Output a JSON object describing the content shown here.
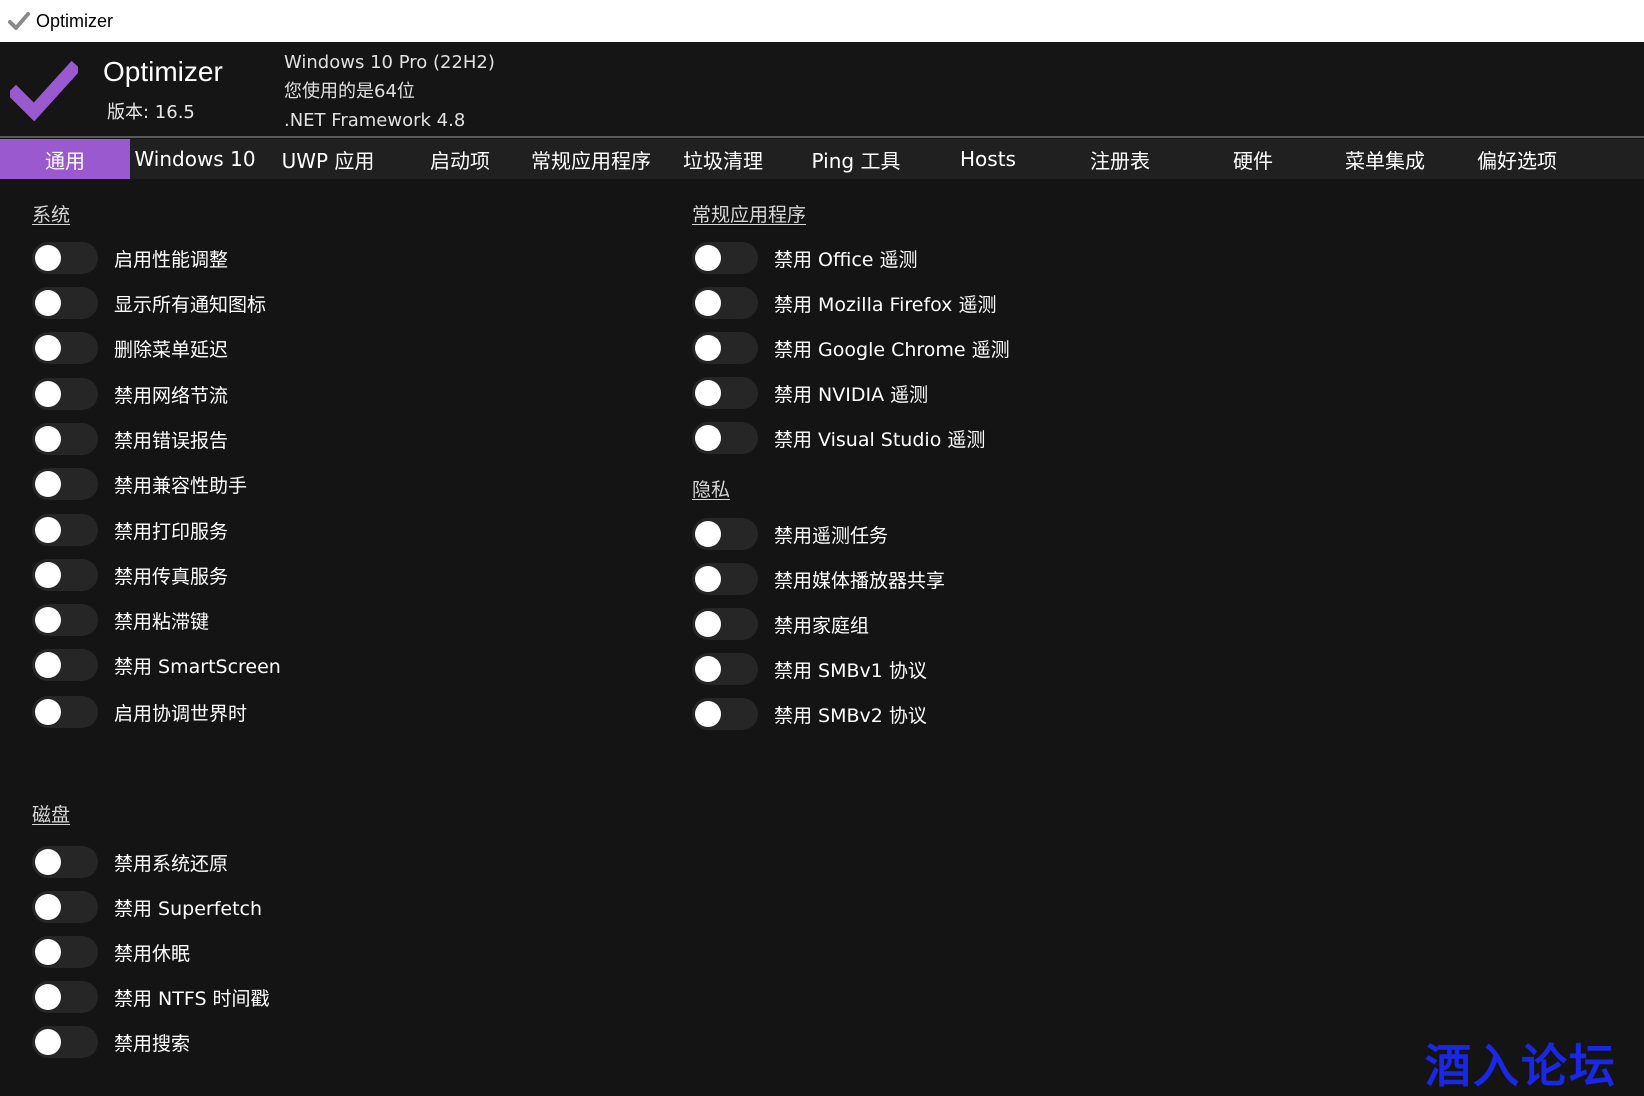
{
  "window": {
    "title": "Optimizer"
  },
  "header": {
    "app_name": "Optimizer",
    "version": "版本: 16.5",
    "os": "Windows 10 Pro (22H2)",
    "arch": "您使用的是64位",
    "framework": ".NET Framework 4.8"
  },
  "colors": {
    "accent": "#9b59d0",
    "background": "#141414",
    "tabbar": "#202020",
    "toggle_off": "#262626",
    "watermark": "#1a27e6"
  },
  "tabs": [
    {
      "label": "通用",
      "active": true
    },
    {
      "label": "Windows 10"
    },
    {
      "label": "UWP 应用"
    },
    {
      "label": "启动项"
    },
    {
      "label": "常规应用程序"
    },
    {
      "label": "垃圾清理"
    },
    {
      "label": "Ping 工具"
    },
    {
      "label": "Hosts"
    },
    {
      "label": "注册表"
    },
    {
      "label": "硬件"
    },
    {
      "label": "菜单集成"
    },
    {
      "label": "偏好选项"
    }
  ],
  "sections": {
    "system": {
      "title": "系统",
      "items": [
        {
          "label": "启用性能调整",
          "on": false
        },
        {
          "label": "显示所有通知图标",
          "on": false
        },
        {
          "label": "删除菜单延迟",
          "on": false
        },
        {
          "label": "禁用网络节流",
          "on": false
        },
        {
          "label": "禁用错误报告",
          "on": false
        },
        {
          "label": "禁用兼容性助手",
          "on": false
        },
        {
          "label": "禁用打印服务",
          "on": false
        },
        {
          "label": "禁用传真服务",
          "on": false
        },
        {
          "label": "禁用粘滞键",
          "on": false
        },
        {
          "label": "禁用 SmartScreen",
          "on": false
        },
        {
          "label": "启用协调世界时",
          "on": false
        }
      ]
    },
    "disk": {
      "title": "磁盘",
      "items": [
        {
          "label": "禁用系统还原",
          "on": false
        },
        {
          "label": "禁用 Superfetch",
          "on": false
        },
        {
          "label": "禁用休眠",
          "on": false
        },
        {
          "label": "禁用 NTFS 时间戳",
          "on": false
        },
        {
          "label": "禁用搜索",
          "on": false
        }
      ]
    },
    "apps": {
      "title": "常规应用程序",
      "items": [
        {
          "label": "禁用 Office 遥测",
          "on": false
        },
        {
          "label": "禁用 Mozilla Firefox 遥测",
          "on": false
        },
        {
          "label": "禁用 Google Chrome 遥测",
          "on": false
        },
        {
          "label": "禁用 NVIDIA 遥测",
          "on": false
        },
        {
          "label": "禁用 Visual Studio 遥测",
          "on": false
        }
      ]
    },
    "privacy": {
      "title": "隐私",
      "items": [
        {
          "label": "禁用遥测任务",
          "on": false
        },
        {
          "label": "禁用媒体播放器共享",
          "on": false
        },
        {
          "label": "禁用家庭组",
          "on": false
        },
        {
          "label": "禁用 SMBv1 协议",
          "on": false
        },
        {
          "label": "禁用 SMBv2 协议",
          "on": false
        }
      ]
    }
  },
  "watermark": "酒入论坛"
}
